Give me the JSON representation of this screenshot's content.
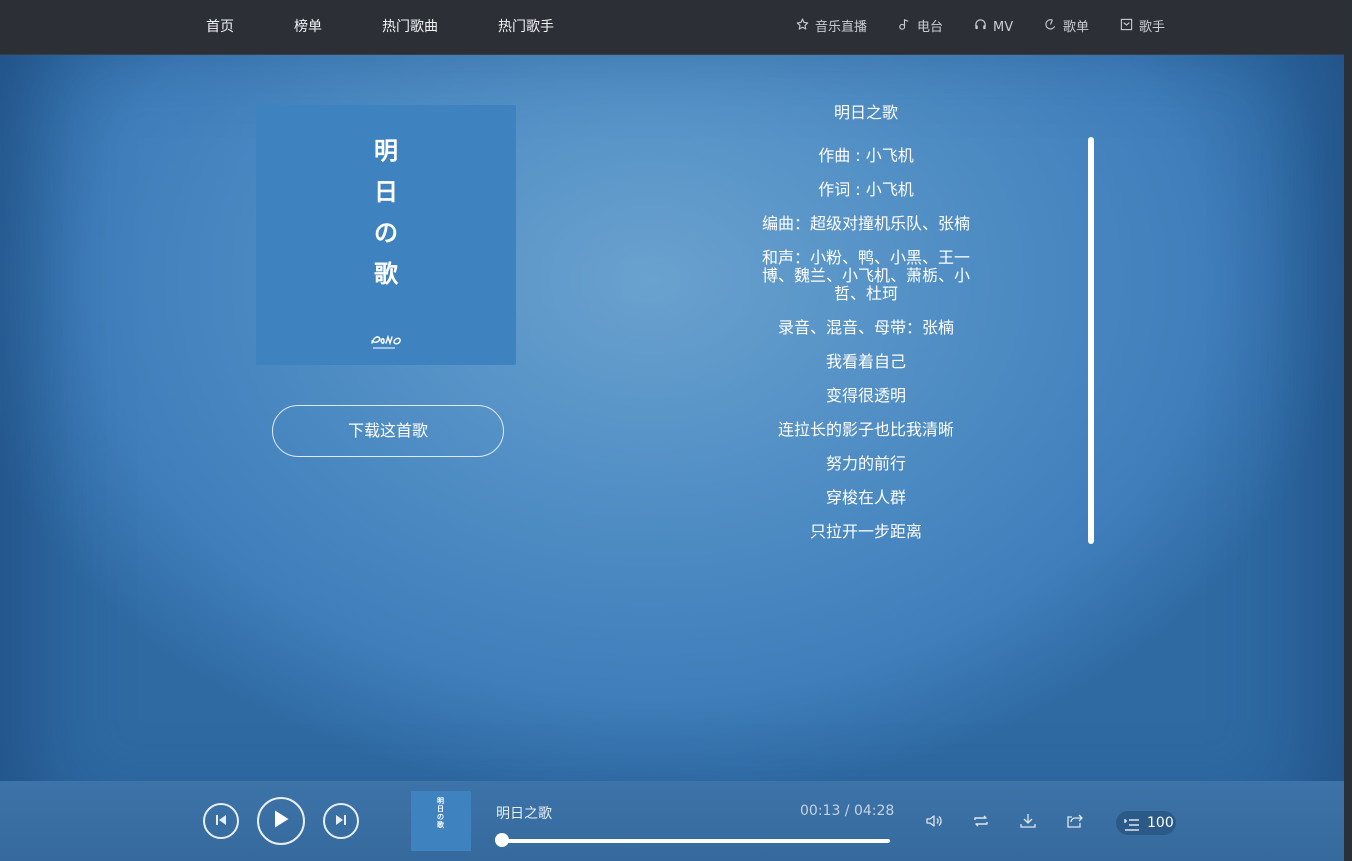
{
  "nav": {
    "left": [
      {
        "label": "首页"
      },
      {
        "label": "榜单"
      },
      {
        "label": "热门歌曲"
      },
      {
        "label": "热门歌手"
      }
    ],
    "right": [
      {
        "label": "音乐直播",
        "icon": "star-icon"
      },
      {
        "label": "电台",
        "icon": "music-note-icon"
      },
      {
        "label": "MV",
        "icon": "headphones-icon"
      },
      {
        "label": "歌单",
        "icon": "disc-icon"
      },
      {
        "label": "歌手",
        "icon": "singer-card-icon"
      }
    ]
  },
  "cover": {
    "title_chars": [
      "明",
      "日",
      "の",
      "歌"
    ],
    "logo_text": "CN ALBUM"
  },
  "download_label": "下载这首歌",
  "song_title": "明日之歌",
  "lyrics": [
    "作曲 : 小飞机",
    "作词 : 小飞机",
    "编曲：超级对撞机乐队、张楠",
    "和声：小粉、鸭、小黑、王一博、魏兰、小飞机、萧栃、小哲、杜珂",
    "录音、混音、母带：张楠",
    "我看着自己",
    "变得很透明",
    "连拉长的影子也比我清晰",
    "努力的前行",
    "穿梭在人群",
    "只拉开一步距离"
  ],
  "player": {
    "title": "明日之歌",
    "time": "00:13 / 04:28",
    "progress": 0.05,
    "playlist_count": "100",
    "controls": [
      "prev-icon",
      "play-icon",
      "next-icon",
      "volume-icon",
      "repeat-icon",
      "download-icon",
      "share-icon",
      "playlist-icon"
    ]
  },
  "colors": {
    "topbar": "#2c2f36",
    "background": "#4a8ac2",
    "cover": "#3f82c0"
  }
}
